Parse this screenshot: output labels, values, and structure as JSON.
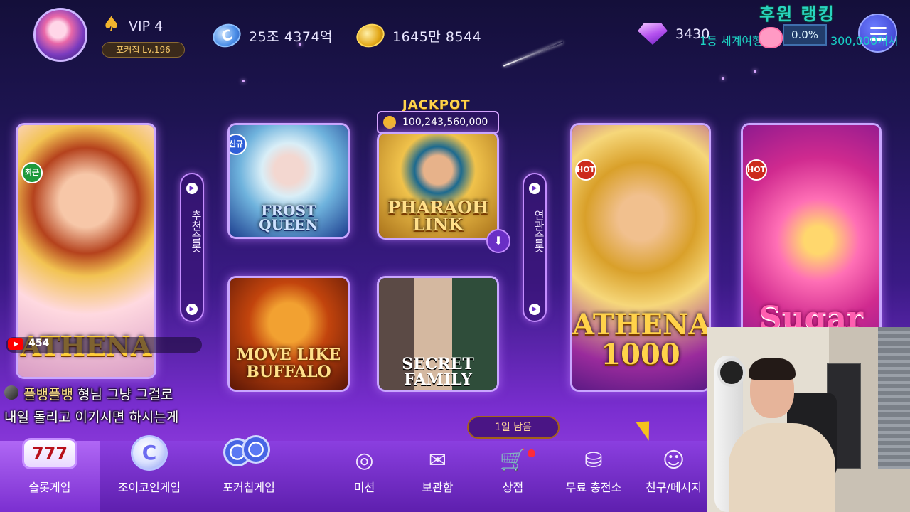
{
  "top": {
    "vip_label": "VIP 4",
    "level_label": "포커칩 Lv.196",
    "coin_balance": "25조 4374억",
    "chip_balance": "1645만 8544",
    "gem_balance": "3430",
    "coin_icon_letter": "C"
  },
  "ranking_overlay": {
    "title": "후원 랭킹",
    "rank_text": "1등 세계여행",
    "percent": "0.0%",
    "total": "300,000개시"
  },
  "side_pills": {
    "left_label": "추천슬롯",
    "right_label": "연관슬롯"
  },
  "jackpot": {
    "label": "JACKPOT",
    "value": "100,243,560,000"
  },
  "games": [
    {
      "title": "ATHENA",
      "badge": "최근"
    },
    {
      "title": "FROST QUEEN",
      "badge": "신규"
    },
    {
      "title": "PHARAOH LINK",
      "badge": ""
    },
    {
      "title": "MOVE LIKE BUFFALO",
      "badge": ""
    },
    {
      "title": "SECRET FAMILY",
      "badge": ""
    },
    {
      "title": "ATHENA 1000",
      "badge": "HOT"
    },
    {
      "title": "Sugar",
      "badge": "HOT"
    }
  ],
  "days_left": "1일 남음",
  "bottom_nav": [
    {
      "label": "슬롯게임",
      "icon": "slot-777-icon",
      "glyph": "777"
    },
    {
      "label": "조이코인게임",
      "icon": "joy-coin-icon",
      "glyph": "C"
    },
    {
      "label": "포커칩게임",
      "icon": "poker-chip-icon",
      "glyph": ""
    },
    {
      "label": "미션",
      "icon": "target-icon",
      "glyph": "◎"
    },
    {
      "label": "보관함",
      "icon": "mail-icon",
      "glyph": "✉"
    },
    {
      "label": "상점",
      "icon": "cart-icon",
      "glyph": "🛒"
    },
    {
      "label": "무료 충전소",
      "icon": "free-chip-icon",
      "glyph": "⛁"
    },
    {
      "label": "친구/메시지",
      "icon": "friends-icon",
      "glyph": "☺"
    }
  ],
  "stream": {
    "viewer_count": "454",
    "chat_user": "플뱅플뱅",
    "chat_line1": "형님 그냥 그걸로",
    "chat_line2": "내일 돌리고 이기시면 하시는게"
  },
  "colors": {
    "accent_purple": "#7a2ed0",
    "gold": "#ffd34d",
    "ranking_teal": "#29d3c0"
  }
}
